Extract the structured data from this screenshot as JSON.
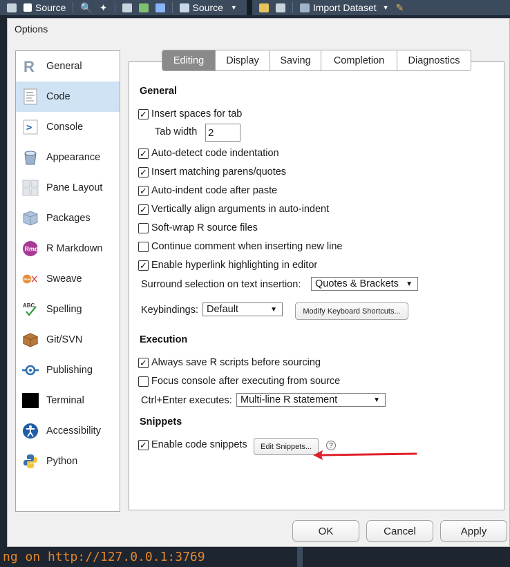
{
  "background": {
    "toolbar": {
      "source_left": "Source",
      "source_button": "Source",
      "import_dataset": "Import Dataset"
    },
    "console_text": "ng on http://127.0.0.1:3769"
  },
  "dialog": {
    "title": "Options",
    "sidebar": [
      {
        "label": "General",
        "icon": "r-logo-icon"
      },
      {
        "label": "Code",
        "icon": "code-document-icon",
        "active": true
      },
      {
        "label": "Console",
        "icon": "console-prompt-icon"
      },
      {
        "label": "Appearance",
        "icon": "paint-bucket-icon"
      },
      {
        "label": "Pane Layout",
        "icon": "pane-layout-icon"
      },
      {
        "label": "Packages",
        "icon": "package-box-icon"
      },
      {
        "label": "R Markdown",
        "icon": "rmd-icon"
      },
      {
        "label": "Sweave",
        "icon": "sweave-icon"
      },
      {
        "label": "Spelling",
        "icon": "spelling-abc-icon"
      },
      {
        "label": "Git/SVN",
        "icon": "git-box-icon"
      },
      {
        "label": "Publishing",
        "icon": "publishing-icon"
      },
      {
        "label": "Terminal",
        "icon": "terminal-icon"
      },
      {
        "label": "Accessibility",
        "icon": "accessibility-icon"
      },
      {
        "label": "Python",
        "icon": "python-icon"
      }
    ],
    "tabs": [
      "Editing",
      "Display",
      "Saving",
      "Completion",
      "Diagnostics"
    ],
    "active_tab": "Editing",
    "general": {
      "title": "General",
      "insert_spaces": {
        "label": "Insert spaces for tab",
        "checked": true
      },
      "tab_width_label": "Tab width",
      "tab_width_value": "2",
      "auto_detect": {
        "label": "Auto-detect code indentation",
        "checked": true
      },
      "matching_parens": {
        "label": "Insert matching parens/quotes",
        "checked": true
      },
      "auto_indent": {
        "label": "Auto-indent code after paste",
        "checked": true
      },
      "vertical_align": {
        "label": "Vertically align arguments in auto-indent",
        "checked": true
      },
      "soft_wrap": {
        "label": "Soft-wrap R source files",
        "checked": false
      },
      "continue_comment": {
        "label": "Continue comment when inserting new line",
        "checked": false
      },
      "hyperlink": {
        "label": "Enable hyperlink highlighting in editor",
        "checked": true
      },
      "surround_label": "Surround selection on text insertion:",
      "surround_value": "Quotes & Brackets",
      "keybindings_label": "Keybindings:",
      "keybindings_value": "Default",
      "modify_shortcuts": "Modify Keyboard Shortcuts..."
    },
    "execution": {
      "title": "Execution",
      "always_save": {
        "label": "Always save R scripts before sourcing",
        "checked": true
      },
      "focus_console": {
        "label": "Focus console after executing from source",
        "checked": false
      },
      "ctrl_enter_label": "Ctrl+Enter executes:",
      "ctrl_enter_value": "Multi-line R statement"
    },
    "snippets": {
      "title": "Snippets",
      "enable": {
        "label": "Enable code snippets",
        "checked": true
      },
      "edit_button": "Edit Snippets...",
      "help": "?"
    },
    "footer": {
      "ok": "OK",
      "cancel": "Cancel",
      "apply": "Apply"
    },
    "annotation_arrow_color": "#e0202a",
    "check_mark": "✓"
  }
}
